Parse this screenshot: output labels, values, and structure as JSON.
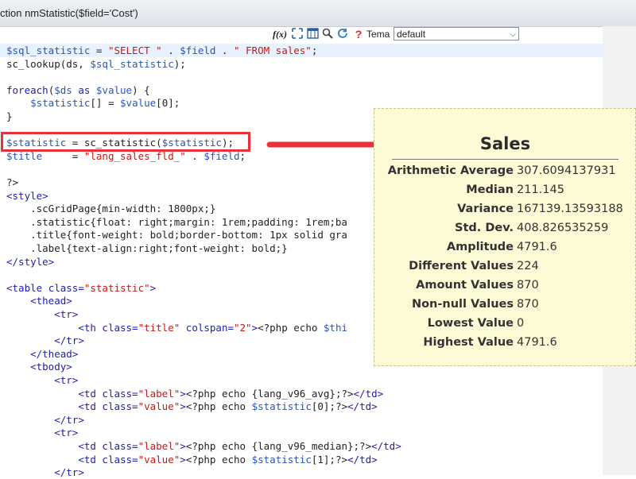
{
  "window": {
    "title": "ction nmStatistic($field='Cost')"
  },
  "toolbar": {
    "icons": [
      "function-icon",
      "expand-icon",
      "panel-icon",
      "search-icon",
      "refresh-icon",
      "help-icon"
    ],
    "fx": "f(x)",
    "help": "?",
    "theme_label": "Tema",
    "theme_value": "default"
  },
  "code": [
    {
      "kind": "line1",
      "t": [
        "$sql_statistic",
        " = ",
        "\"SELECT \"",
        " . ",
        "$field",
        " . ",
        "\" FROM sales\"",
        ";"
      ]
    },
    {
      "kind": "line2",
      "t": [
        "sc_lookup(ds, ",
        "$sql_statistic",
        ");"
      ]
    },
    {
      "kind": "blank"
    },
    {
      "kind": "line4",
      "t": [
        "foreach",
        "(",
        "$ds",
        " as ",
        "$value",
        ") {"
      ]
    },
    {
      "kind": "line5",
      "t": [
        "    ",
        "$statistic",
        "[] = ",
        "$value",
        "[0];"
      ]
    },
    {
      "kind": "line6",
      "t": [
        "}"
      ]
    },
    {
      "kind": "blank"
    },
    {
      "kind": "line8",
      "t": [
        "$statistic",
        " = sc_statistic(",
        "$statistic",
        ");"
      ]
    },
    {
      "kind": "line9",
      "t": [
        "$title",
        "     = ",
        "\"lang_sales_fld_\"",
        " . ",
        "$field",
        ";"
      ]
    },
    {
      "kind": "blank"
    },
    {
      "kind": "line11",
      "t": [
        "?>"
      ]
    },
    {
      "kind": "line12",
      "t": [
        "<style>"
      ]
    },
    {
      "kind": "line13",
      "t": [
        "    .scGridPage{min-width: 1800px;}"
      ]
    },
    {
      "kind": "line14",
      "t": [
        "    .statistic{float: right;margin: 1rem;padding: 1rem;ba"
      ]
    },
    {
      "kind": "line15",
      "t": [
        "    .title{font-weight: bold;border-bottom: 1px solid gra"
      ]
    },
    {
      "kind": "line16",
      "t": [
        "    .label{text-align:right;font-weight: bold;}"
      ]
    },
    {
      "kind": "line17",
      "t": [
        "</style>"
      ]
    },
    {
      "kind": "blank"
    },
    {
      "kind": "line19",
      "t": [
        "<table ",
        "class=",
        "\"statistic\"",
        ">"
      ]
    },
    {
      "kind": "line20",
      "t": [
        "    ",
        "<thead>"
      ]
    },
    {
      "kind": "line21",
      "t": [
        "        ",
        "<tr>"
      ]
    },
    {
      "kind": "line22",
      "t": [
        "            ",
        "<th ",
        "class=",
        "\"title\"",
        " colspan=",
        "\"2\"",
        ">",
        "<?php echo ",
        "$thi"
      ]
    },
    {
      "kind": "line23",
      "t": [
        "        ",
        "</tr>"
      ]
    },
    {
      "kind": "line24",
      "t": [
        "    ",
        "</thead>"
      ]
    },
    {
      "kind": "line25",
      "t": [
        "    ",
        "<tbody>"
      ]
    },
    {
      "kind": "line26",
      "t": [
        "        ",
        "<tr>"
      ]
    },
    {
      "kind": "line27",
      "t": [
        "            ",
        "<td ",
        "class=",
        "\"label\"",
        ">",
        "<?php echo {lang_v96_avg};?>",
        "</td>"
      ]
    },
    {
      "kind": "line28",
      "t": [
        "            ",
        "<td ",
        "class=",
        "\"value\"",
        ">",
        "<?php echo ",
        "$statistic",
        "[0];?>",
        "</td>"
      ]
    },
    {
      "kind": "line29",
      "t": [
        "        ",
        "</tr>"
      ]
    },
    {
      "kind": "line30",
      "t": [
        "        ",
        "<tr>"
      ]
    },
    {
      "kind": "line31",
      "t": [
        "            ",
        "<td ",
        "class=",
        "\"label\"",
        ">",
        "<?php echo {lang_v96_median};?>",
        "</td>"
      ]
    },
    {
      "kind": "line32",
      "t": [
        "            ",
        "<td ",
        "class=",
        "\"value\"",
        ">",
        "<?php echo ",
        "$statistic",
        "[1];?>",
        "</td>"
      ]
    },
    {
      "kind": "line33",
      "t": [
        "        ",
        "</tr>"
      ]
    }
  ],
  "stats_panel": {
    "title": "Sales",
    "rows": [
      {
        "label": "Arithmetic Average",
        "value": "307.6094137931"
      },
      {
        "label": "Median",
        "value": "211.145"
      },
      {
        "label": "Variance",
        "value": "167139.13593188"
      },
      {
        "label": "Std. Dev.",
        "value": "408.826535259"
      },
      {
        "label": "Amplitude",
        "value": "4791.6"
      },
      {
        "label": "Different Values",
        "value": "224"
      },
      {
        "label": "Amount Values",
        "value": "870"
      },
      {
        "label": "Non-null Values",
        "value": "870"
      },
      {
        "label": "Lowest Value",
        "value": "0"
      },
      {
        "label": "Highest Value",
        "value": "4791.6"
      }
    ]
  },
  "colors": {
    "callout": "#e8323a",
    "panel_bg": "#fdfbd6",
    "string": "#c41a16",
    "keyword": "#1e1eaa"
  }
}
